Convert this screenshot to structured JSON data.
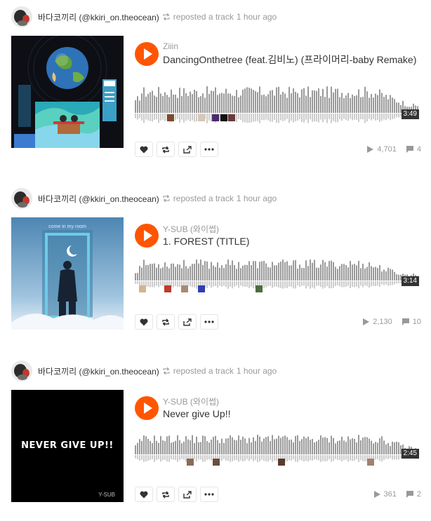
{
  "posts": [
    {
      "user": "바다코끼리",
      "handle": "(@kkiri_on.theocean)",
      "repost_text": "reposted a track",
      "time": "1 hour ago",
      "artist": "Ziiin",
      "title": "DancingOnthetree (feat.김비노) (프라이머리-baby Remake)",
      "duration": "3:49",
      "plays": "4,701",
      "comments": "4",
      "cover": "earth-illustration"
    },
    {
      "user": "바다코끼리",
      "handle": "(@kkiri_on.theocean)",
      "repost_text": "reposted a track",
      "time": "1 hour ago",
      "artist": "Y-SUB (와이썹)",
      "title": "1. FOREST (TITLE)",
      "duration": "3:14",
      "plays": "2,130",
      "comments": "10",
      "cover_text": "come in my room"
    },
    {
      "user": "바다코끼리",
      "handle": "(@kkiri_on.theocean)",
      "repost_text": "reposted a track",
      "time": "1 hour ago",
      "artist": "Y-SUB (와이썹)",
      "title": "Never give Up!!",
      "duration": "2:45",
      "plays": "361",
      "comments": "2",
      "cover_text": "NEVER GIVE UP!!",
      "cover_sub": "Y-SUB"
    }
  ],
  "colors": {
    "accent": "#ff5500",
    "wave": "#999999",
    "wave_light": "#cccccc"
  },
  "icons": [
    "heart-icon",
    "repost-icon",
    "share-icon",
    "more-icon",
    "play-icon",
    "plays-icon",
    "comment-icon"
  ]
}
